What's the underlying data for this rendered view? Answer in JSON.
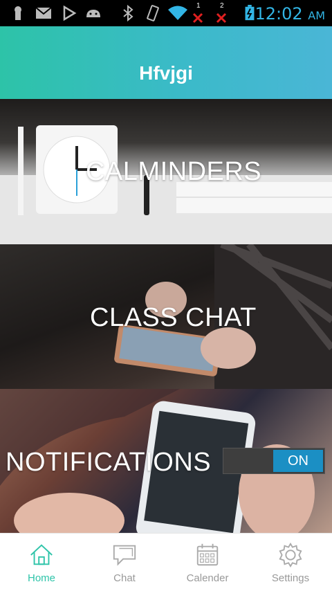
{
  "status_bar": {
    "time": "12:02",
    "ampm": "AM",
    "sim1": "1",
    "sim2": "2",
    "time_color": "#32b5e5"
  },
  "app_bar": {
    "title": "Hfvjgi",
    "gradient_colors": [
      "#2dc3a8",
      "#4ab6d6"
    ]
  },
  "tiles": [
    {
      "label": "CALMINDERS"
    },
    {
      "label": "CLASS CHAT"
    },
    {
      "label": "NOTIFICATIONS",
      "toggle_state": "ON"
    }
  ],
  "bottom_nav": {
    "items": [
      {
        "label": "Home",
        "icon": "home-icon",
        "active": true
      },
      {
        "label": "Chat",
        "icon": "chat-icon",
        "active": false
      },
      {
        "label": "Calender",
        "icon": "calendar-icon",
        "active": false
      },
      {
        "label": "Settings",
        "icon": "gear-icon",
        "active": false
      }
    ],
    "active_color": "#2ec4a9",
    "inactive_color": "#999999"
  }
}
